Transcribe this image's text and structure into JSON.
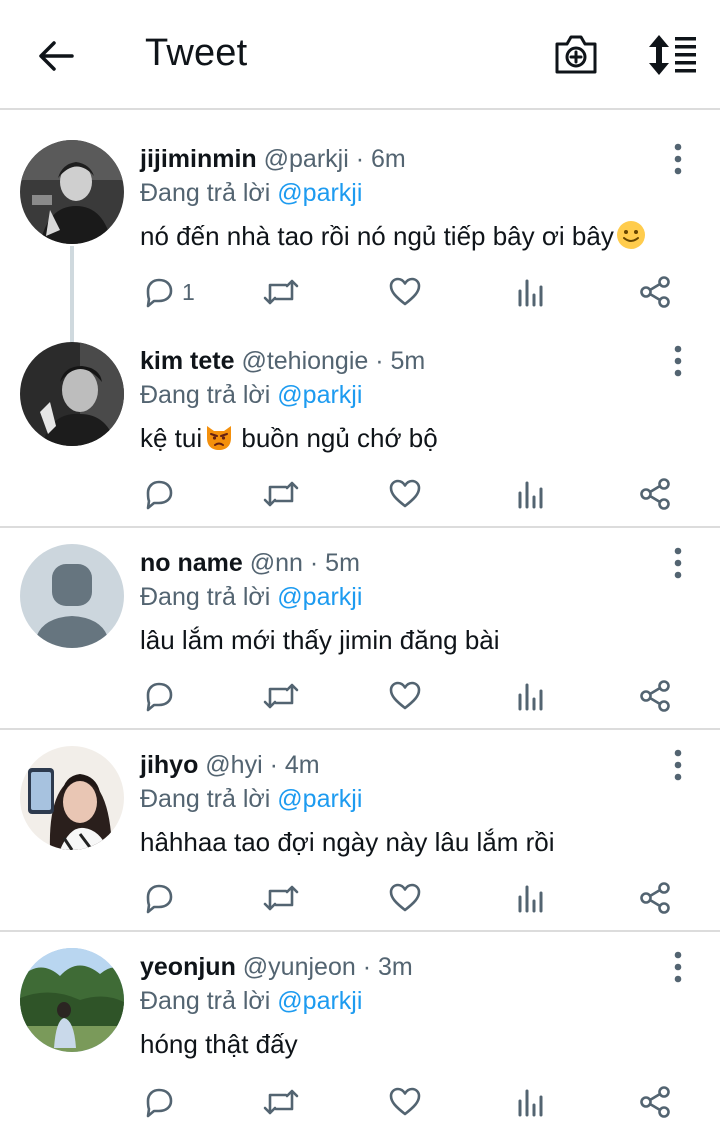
{
  "header": {
    "title": "Tweet",
    "back_icon": "arrow-left-icon",
    "camera_icon": "camera-plus-icon",
    "sort_icon": "sort-list-icon"
  },
  "colors": {
    "accent": "#1d9bf0",
    "muted": "#536471",
    "text": "#0f1419",
    "divider": "#dcdcdc"
  },
  "tweets": [
    {
      "name": "jijiminmin",
      "handle": "@parkji",
      "sep": "·",
      "time": "6m",
      "reply_prefix": "Đang trả lời",
      "reply_to": "@parkji",
      "text": "nó đến nhà tao rồi nó ngủ tiếp bây ơi bây",
      "emoji": "slightly-smiling-face",
      "reply_count": "1"
    },
    {
      "name": "kim tete",
      "handle": "@tehiongie",
      "sep": "·",
      "time": "5m",
      "reply_prefix": "Đang trả lời",
      "reply_to": "@parkji",
      "text_before": "kệ tui",
      "emoji": "pouting-cat-face",
      "text_after": " buồn ngủ chớ bộ",
      "reply_count": ""
    },
    {
      "name": "no name",
      "handle": "@nn",
      "sep": "·",
      "time": "5m",
      "reply_prefix": "Đang trả lời",
      "reply_to": "@parkji",
      "text": "lâu lắm mới thấy jimin đăng bài",
      "reply_count": ""
    },
    {
      "name": "jihyo",
      "handle": "@hyi",
      "sep": "·",
      "time": "4m",
      "reply_prefix": "Đang trả lời",
      "reply_to": "@parkji",
      "text": "hâhhaa tao đợi ngày này lâu lắm rồi",
      "reply_count": ""
    },
    {
      "name": "yeonjun",
      "handle": "@yunjeon",
      "sep": "·",
      "time": "3m",
      "reply_prefix": "Đang trả lời",
      "reply_to": "@parkji",
      "text": "hóng thật đấy",
      "reply_count": ""
    }
  ],
  "action_icons": [
    "reply-icon",
    "retweet-icon",
    "like-icon",
    "analytics-icon",
    "share-icon"
  ]
}
